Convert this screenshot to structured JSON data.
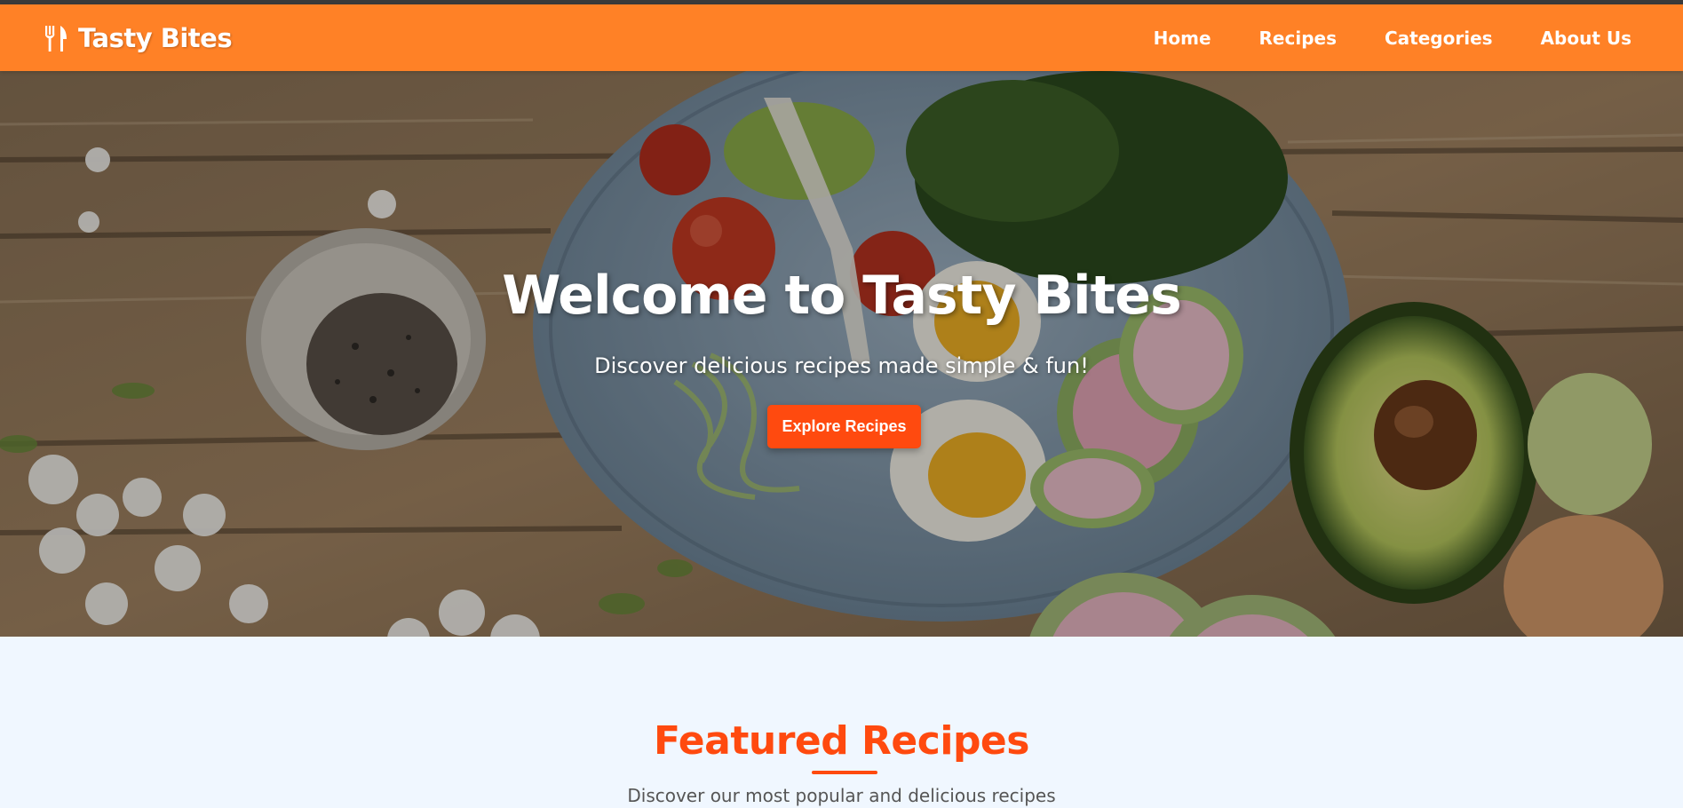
{
  "nav": {
    "brand": "Tasty Bites",
    "brand_icon": "utensils-icon",
    "links": [
      "Home",
      "Recipes",
      "Categories",
      "About Us"
    ]
  },
  "hero": {
    "title": "Welcome to Tasty Bites",
    "subtitle": "Discover delicious recipes made simple & fun!",
    "button": "Explore Recipes"
  },
  "featured": {
    "title": "Featured Recipes",
    "subtitle": "Discover our most popular and delicious recipes"
  },
  "colors": {
    "navbar": "#ff8126",
    "accent": "#ff4a0f",
    "page_bg": "#f0f7ff"
  }
}
